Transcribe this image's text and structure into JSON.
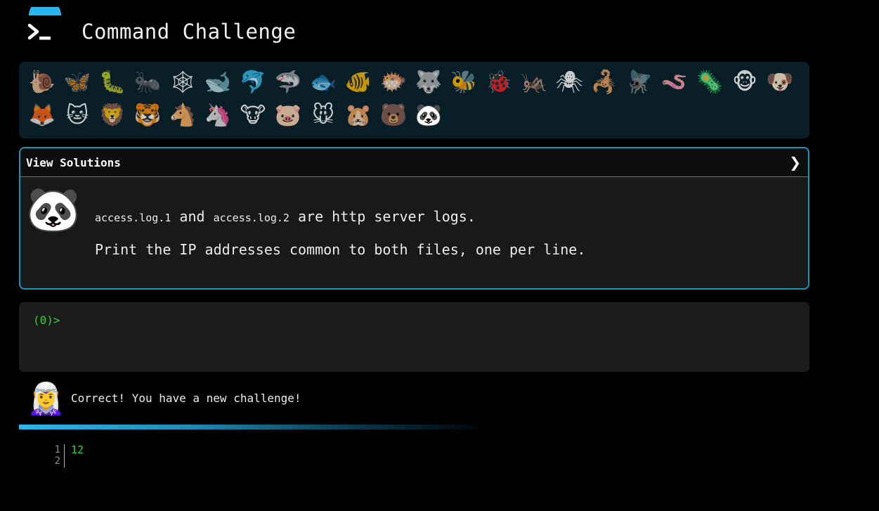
{
  "header": {
    "title": "Command Challenge",
    "icon": "terminal-prompt-icon",
    "accent_color": "#2ab7ef"
  },
  "animals": {
    "items": [
      {
        "name": "snail",
        "glyph": "🐌"
      },
      {
        "name": "butterfly",
        "glyph": "🦋"
      },
      {
        "name": "caterpillar",
        "glyph": "🐛"
      },
      {
        "name": "ant",
        "glyph": "🐜"
      },
      {
        "name": "spider-web",
        "glyph": "🕸"
      },
      {
        "name": "whale",
        "glyph": "🐋"
      },
      {
        "name": "dolphin",
        "glyph": "🐬"
      },
      {
        "name": "shark",
        "glyph": "🦈"
      },
      {
        "name": "fish",
        "glyph": "🐟"
      },
      {
        "name": "tropical-fish",
        "glyph": "🐠"
      },
      {
        "name": "blowfish",
        "glyph": "🐡"
      },
      {
        "name": "wolf",
        "glyph": "🐺"
      },
      {
        "name": "bee",
        "glyph": "🐝"
      },
      {
        "name": "ladybug",
        "glyph": "🐞"
      },
      {
        "name": "cricket",
        "glyph": "🦗"
      },
      {
        "name": "spider",
        "glyph": "🕷"
      },
      {
        "name": "scorpion",
        "glyph": "🦂"
      },
      {
        "name": "fly",
        "glyph": "🪰"
      },
      {
        "name": "worm",
        "glyph": "🪱"
      },
      {
        "name": "microbe",
        "glyph": "🦠"
      },
      {
        "name": "monkey",
        "glyph": "🐵"
      },
      {
        "name": "dog",
        "glyph": "🐶"
      },
      {
        "name": "fox",
        "glyph": "🦊"
      },
      {
        "name": "cat",
        "glyph": "🐱"
      },
      {
        "name": "lion",
        "glyph": "🦁"
      },
      {
        "name": "tiger",
        "glyph": "🐯"
      },
      {
        "name": "horse",
        "glyph": "🐴"
      },
      {
        "name": "unicorn",
        "glyph": "🦄"
      },
      {
        "name": "cow",
        "glyph": "🐮"
      },
      {
        "name": "pig",
        "glyph": "🐷"
      },
      {
        "name": "mouse",
        "glyph": "🐭"
      },
      {
        "name": "hamster",
        "glyph": "🐹"
      },
      {
        "name": "bear",
        "glyph": "🐻"
      },
      {
        "name": "panda",
        "glyph": "🐼",
        "active": true
      }
    ]
  },
  "solutions": {
    "header_label": "View Solutions",
    "chevron": "❯",
    "avatar": "🐼",
    "line1": {
      "file1": "access.log.1",
      "and": " and ",
      "file2": "access.log.2",
      "rest": " are http server logs."
    },
    "line2": "Print the IP addresses common to both files, one per line."
  },
  "terminal": {
    "prompt": "(0)>"
  },
  "notification": {
    "avatar": "🧝‍♀️",
    "message": "Correct! You have a new challenge!"
  },
  "output": {
    "line_numbers": [
      "1",
      "2"
    ],
    "lines": [
      "12"
    ]
  }
}
